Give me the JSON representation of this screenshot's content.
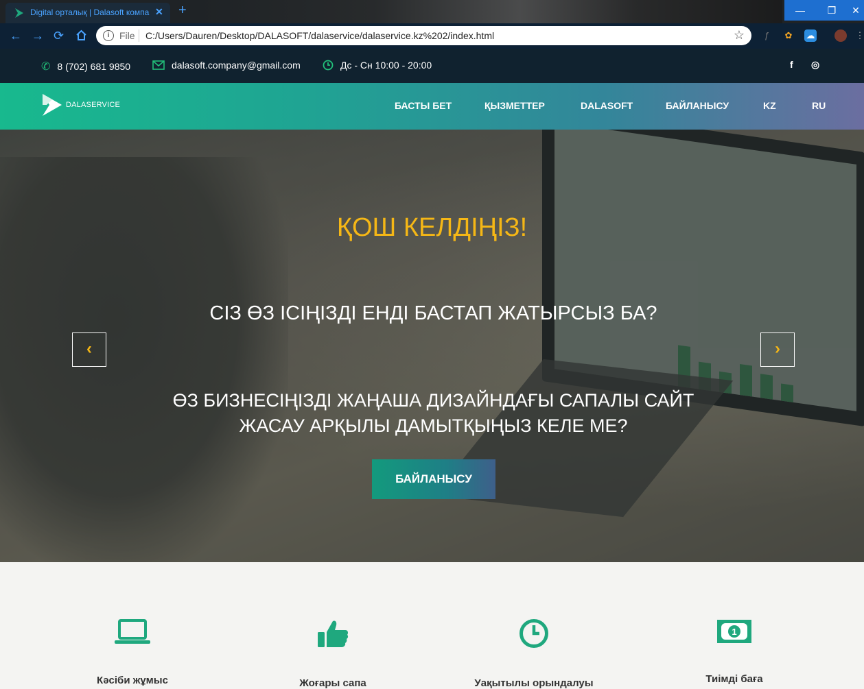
{
  "browser": {
    "tab_title": "Digital орталық | Dalasoft компа",
    "new_tab": "+",
    "file_label": "File",
    "url": "C:/Users/Dauren/Desktop/DALASOFT/dalaservice/dalaservice.kz%202/index.html",
    "window_buttons": [
      "—",
      "❐",
      "✕"
    ]
  },
  "contact": {
    "phone": "8 (702) 681 9850",
    "email": "dalasoft.company@gmail.com",
    "hours": "Дс - Сн 10:00 - 20:00",
    "social": [
      "f",
      "◎"
    ]
  },
  "nav": {
    "logo_text": "DALASERVICE",
    "items": [
      "БАСТЫ БЕТ",
      "ҚЫЗМЕТТЕР",
      "DALASOFT",
      "БАЙЛАНЫСУ",
      "KZ",
      "RU"
    ]
  },
  "hero": {
    "welcome": "ҚОШ КЕЛДІҢІЗ!",
    "question1": "СІЗ ӨЗ ІСІҢІЗДІ ЕНДІ БАСТАП ЖАТЫРСЫЗ БА?",
    "question2_line1": "ӨЗ БИЗНЕСІҢІЗДІ ЖАҢАША ДИЗАЙНДАҒЫ САПАЛЫ САЙТ",
    "question2_line2": "ЖАСАУ АРҚЫЛЫ ДАМЫТҚЫҢЫЗ КЕЛЕ МЕ?",
    "cta_label": "БАЙЛАНЫСУ",
    "prev_arrow": "‹",
    "next_arrow": "›"
  },
  "features": {
    "accent_color": "#1fa87e",
    "items": [
      {
        "icon": "laptop-icon",
        "label": "Кәсіби жұмыс"
      },
      {
        "icon": "thumbs-up-icon",
        "label": "Жоғары сапа"
      },
      {
        "icon": "clock-icon",
        "label": "Уақытылы орындалуы"
      },
      {
        "icon": "money-icon",
        "label": "Тиімді баға"
      }
    ]
  }
}
